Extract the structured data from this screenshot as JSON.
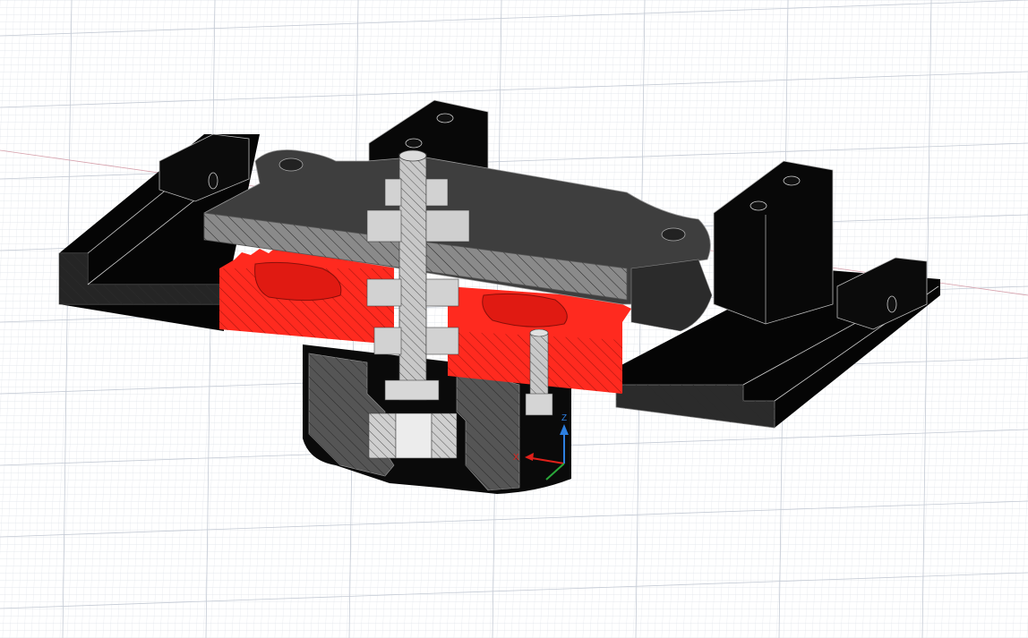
{
  "viewport": {
    "background": "#ffffff",
    "grid_minor_color": "#d3d8e0",
    "grid_major_color": "#c0c7d2",
    "axis_line_color": "#d49aa6"
  },
  "model": {
    "section_fill": "#ff2a1f",
    "dark_body": "#0a0a0a",
    "gray_plate": "#4a4a4a",
    "steel": "#bdbdbd"
  },
  "triad": {
    "x_label": "X",
    "z_label": "Z",
    "x_color": "#e0201a",
    "z_color": "#2d7fe0",
    "y_color": "#2aa83a"
  }
}
